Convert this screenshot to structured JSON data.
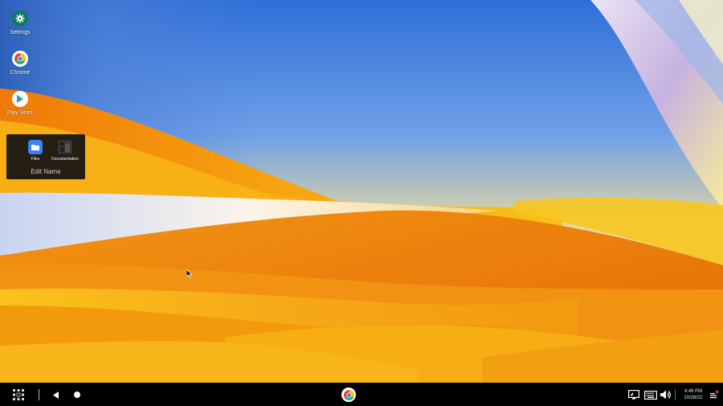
{
  "desktop": {
    "icons": [
      {
        "label": "Settings",
        "icon": "gear-icon",
        "color": "#0f7a62"
      },
      {
        "label": "Chrome",
        "icon": "chrome-icon"
      },
      {
        "label": "Play Store",
        "icon": "play-store-icon"
      }
    ],
    "folder": {
      "name": "Edit Name",
      "items": [
        {
          "label": "Files",
          "icon": "files-icon",
          "color": "#3b82f6"
        },
        {
          "label": "Documentation",
          "icon": "documentation-icon"
        }
      ]
    }
  },
  "taskbar": {
    "pinned": [
      {
        "icon": "chrome-icon"
      }
    ],
    "tray": {
      "time": "4:46 PM",
      "date": "10/26/22"
    }
  },
  "colors": {
    "taskbar_bg": "#000000",
    "wallpaper_sky": "#4f88e0",
    "wallpaper_orange": "#f29a0a",
    "wallpaper_yellow": "#f5c400"
  }
}
